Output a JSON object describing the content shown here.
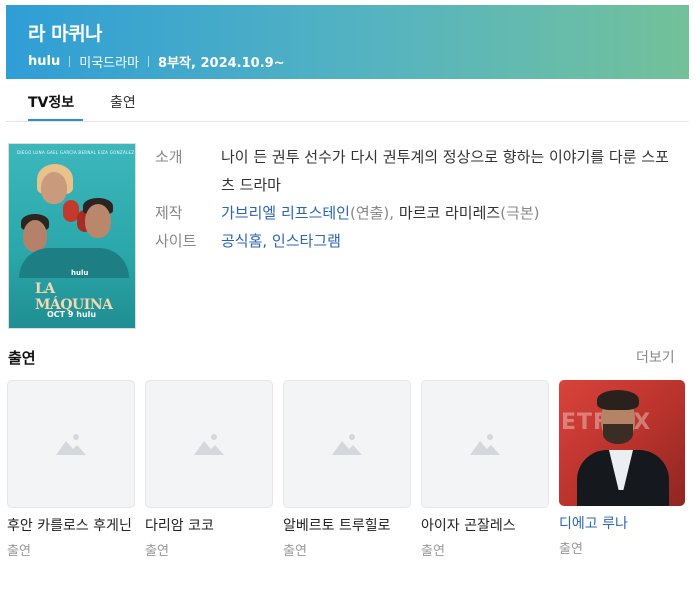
{
  "header": {
    "title": "라 마퀴나",
    "network": "hulu",
    "genre": "미국드라마",
    "episodes_date": "8부작, 2024.10.9~"
  },
  "tabs": [
    {
      "label": "TV정보",
      "active": true
    },
    {
      "label": "출연",
      "active": false
    }
  ],
  "poster": {
    "top_credits": "DIEGO LUNA   GAEL GARCÍA BERNAL   EIZA GONZÁLEZ",
    "brand": "hulu",
    "title": "LA MÁQUINA",
    "date": "OCT 9 hulu"
  },
  "info": {
    "synopsis_label": "소개",
    "synopsis": "나이 든 권투 선수가 다시 권투계의 정상으로 향하는 이야기를 다룬 스포츠 드라마",
    "production_label": "제작",
    "director_name": "가브리엘 리프스테인",
    "director_role": "(연출), ",
    "writer_name": "마르코 라미레즈",
    "writer_role": "(극본)",
    "site_label": "사이트",
    "site_links": "공식홈, 인스타그램"
  },
  "cast_section": {
    "title": "출연",
    "more": "더보기",
    "members": [
      {
        "name": "후안 카를로스 후게닌",
        "role": "출연",
        "has_photo": false
      },
      {
        "name": "다리암 코코",
        "role": "출연",
        "has_photo": false
      },
      {
        "name": "알베르토 트루힐로",
        "role": "출연",
        "has_photo": false
      },
      {
        "name": "아이자 곤잘레스",
        "role": "출연",
        "has_photo": false
      },
      {
        "name": "디에고 루나",
        "role": "출연",
        "has_photo": true,
        "photo_backdrop": "ETFLIX"
      }
    ]
  },
  "colors": {
    "header_gradient_start": "#2f9ed6",
    "header_gradient_end": "#73c19a",
    "link": "#2a66b7",
    "tab_underline": "#2f8fc8"
  },
  "icons": {
    "placeholder": "image-placeholder-icon"
  }
}
